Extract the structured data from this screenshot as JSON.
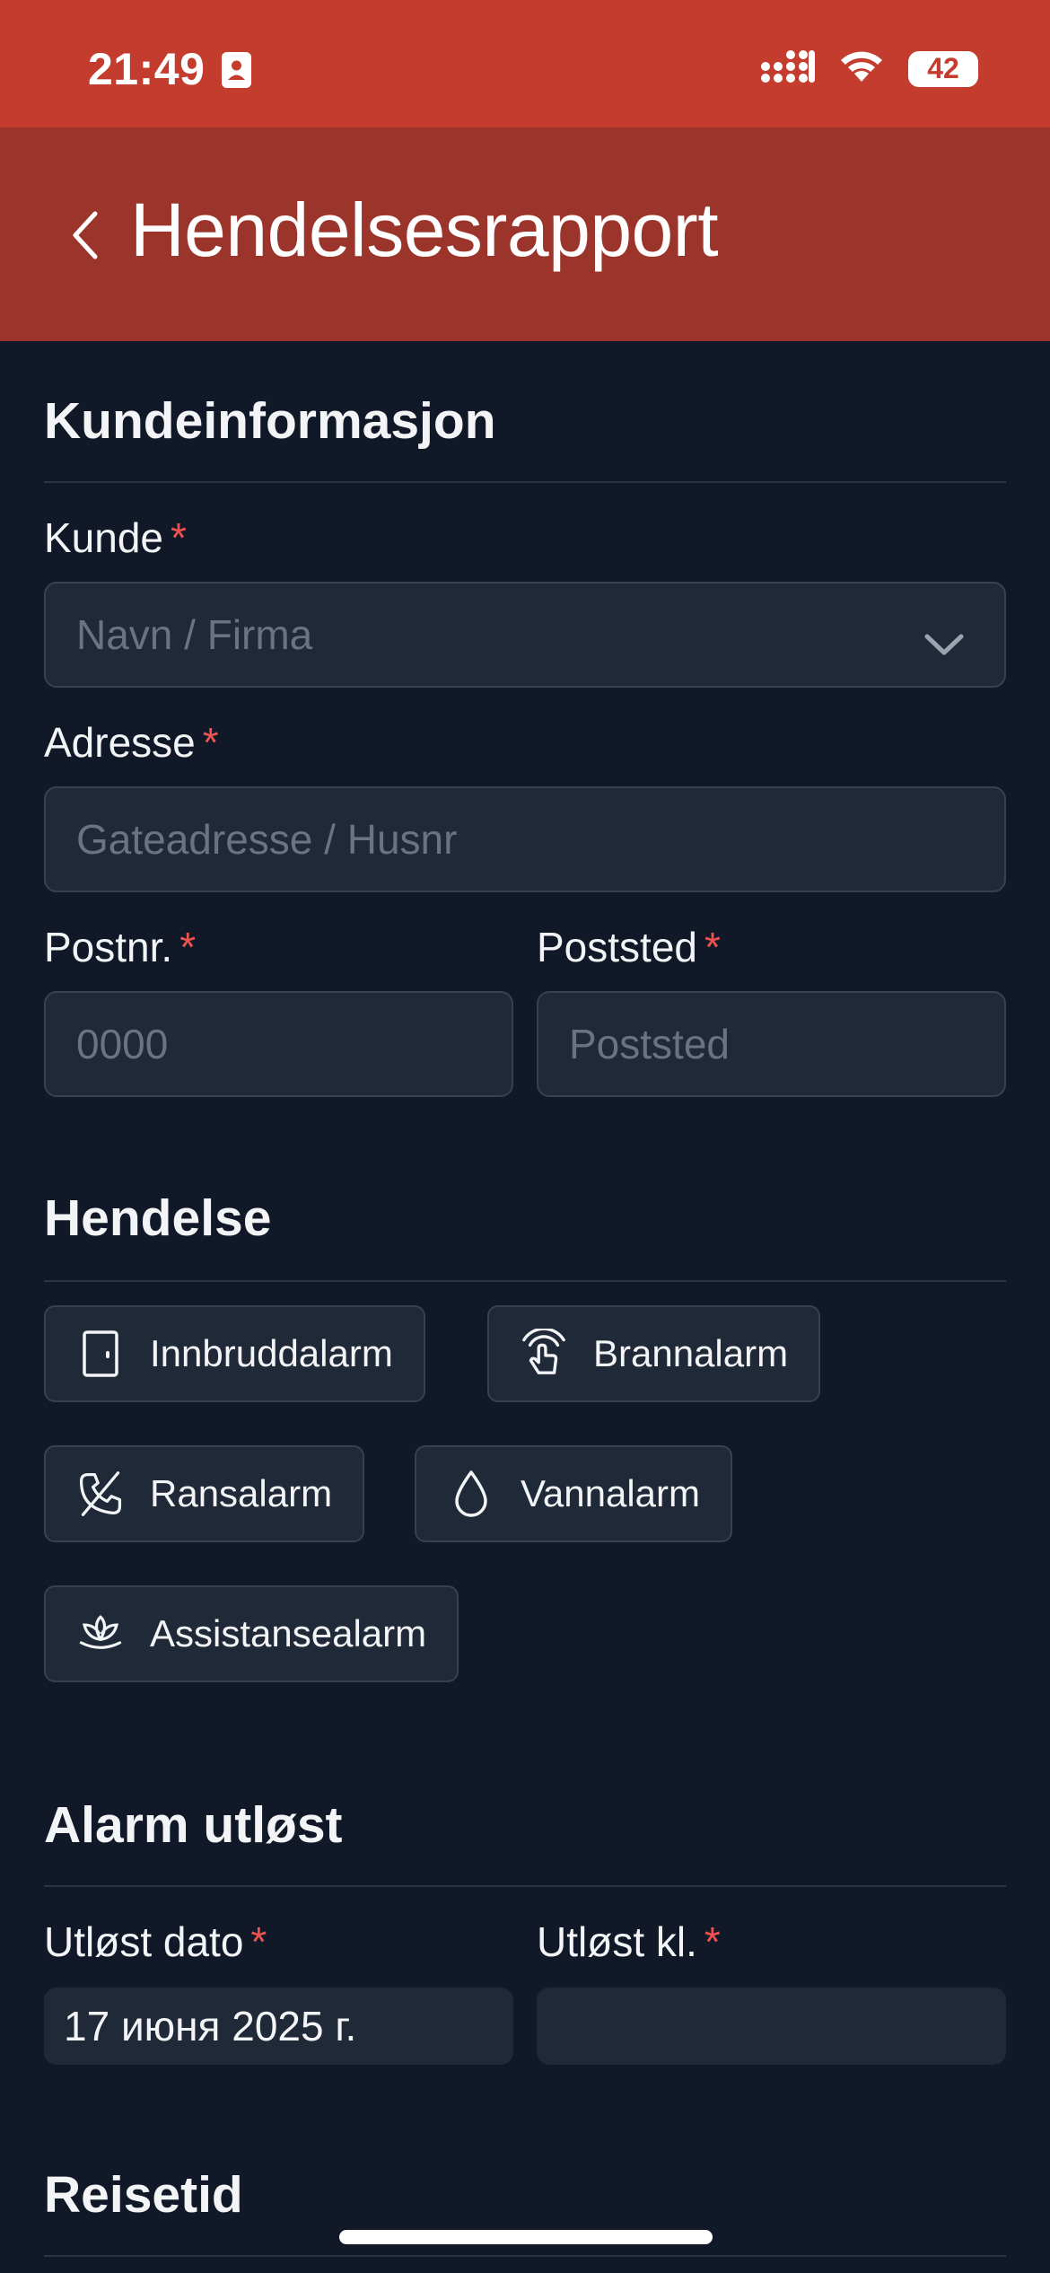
{
  "status_bar": {
    "time": "21:49",
    "battery_level": "42",
    "background_color": "#c43c2e"
  },
  "header": {
    "title": "Hendelsesrapport",
    "background_color": "#9b342b"
  },
  "sections": {
    "customer": {
      "title": "Kundeinformasjon",
      "kunde": {
        "label": "Kunde",
        "required": "*",
        "placeholder": "Navn / Firma"
      },
      "adresse": {
        "label": "Adresse",
        "required": "*",
        "placeholder": "Gateadresse / Husnr"
      },
      "postnr": {
        "label": "Postnr.",
        "required": "*",
        "placeholder": "0000"
      },
      "poststed": {
        "label": "Poststed",
        "required": "*",
        "placeholder": "Poststed"
      }
    },
    "event": {
      "title": "Hendelse",
      "options": [
        {
          "label": "Innbruddalarm",
          "icon": "door-icon"
        },
        {
          "label": "Brannalarm",
          "icon": "alarm-touch-icon"
        },
        {
          "label": "Ransalarm",
          "icon": "phone-slash-icon"
        },
        {
          "label": "Vannalarm",
          "icon": "water-drop-icon"
        },
        {
          "label": "Assistansealarm",
          "icon": "lotus-icon"
        }
      ]
    },
    "alarm": {
      "title": "Alarm utløst",
      "date": {
        "label": "Utløst dato",
        "required": "*",
        "value": "17 июня 2025 г."
      },
      "time": {
        "label": "Utløst kl.",
        "required": "*",
        "value": ""
      }
    },
    "travel": {
      "title": "Reisetid"
    }
  },
  "colors": {
    "page_background": "#111827",
    "input_background": "#1f2937",
    "input_border": "#374151",
    "required_marker": "#ef5350"
  }
}
